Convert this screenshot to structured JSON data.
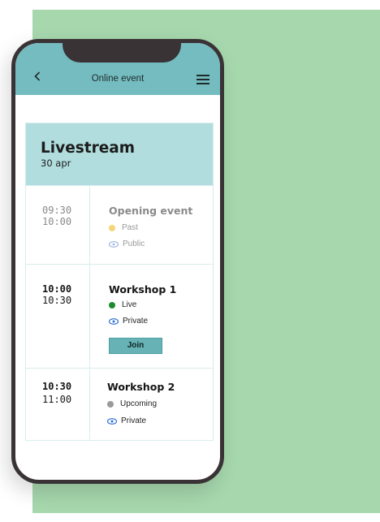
{
  "header": {
    "title": "Online event",
    "back_icon": "chevron-left-icon",
    "menu_icon": "hamburger-menu-icon"
  },
  "day": {
    "title": "Livestream",
    "date": "30 apr"
  },
  "events": [
    {
      "start": "09:30",
      "end": "10:00",
      "title": "Opening event",
      "status": "Past",
      "status_color": "#f5d57a",
      "visibility": "Public"
    },
    {
      "start": "10:00",
      "end": "10:30",
      "title": "Workshop 1",
      "status": "Live",
      "status_color": "#1d8a2e",
      "visibility": "Private",
      "action": "Join"
    },
    {
      "start": "10:30",
      "end": "11:00",
      "title": "Workshop 2",
      "status": "Upcoming",
      "status_color": "#9a9a9a",
      "visibility": "Private"
    }
  ],
  "colors": {
    "background_card": "#a6d7ad",
    "header": "#74bcc0",
    "day_header": "#b1ddde",
    "accent": "#66b2b4"
  }
}
